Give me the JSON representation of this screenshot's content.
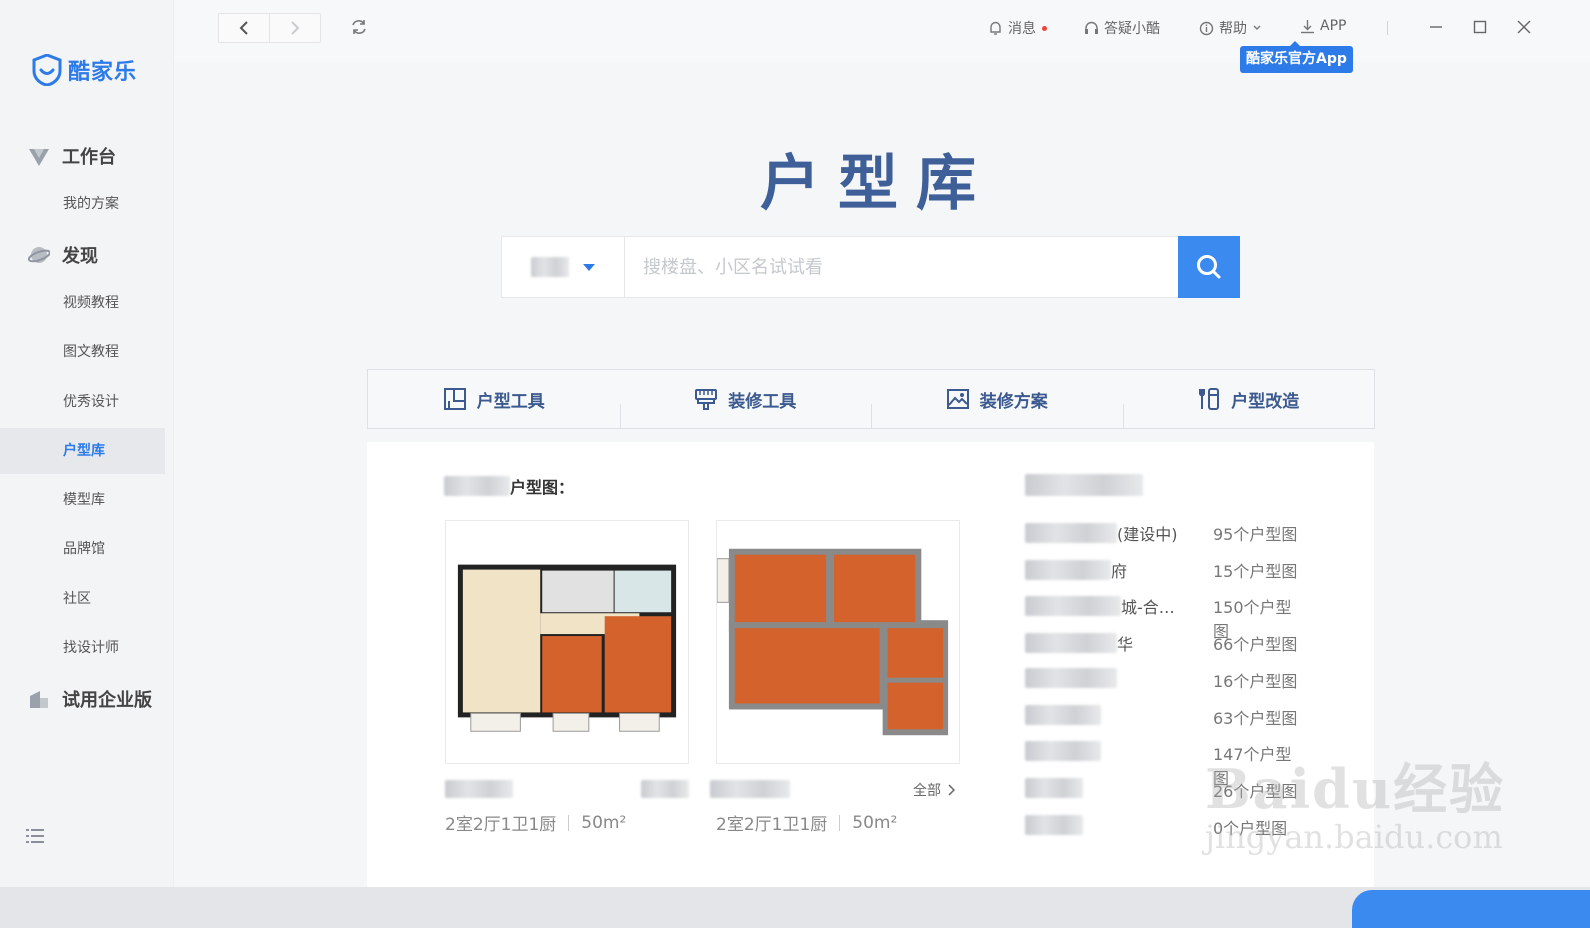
{
  "app": {
    "logo_text": "酷家乐",
    "brand_color": "#2d7be8"
  },
  "sidebar": {
    "groups": [
      {
        "label": "工作台",
        "icon": "workbench-icon"
      },
      {
        "label": "发现",
        "icon": "planet-icon"
      },
      {
        "label": "试用企业版",
        "icon": "enterprise-icon"
      }
    ],
    "items": [
      {
        "label": "我的方案"
      },
      {
        "label": "视频教程"
      },
      {
        "label": "图文教程"
      },
      {
        "label": "优秀设计"
      },
      {
        "label": "户型库",
        "active": true
      },
      {
        "label": "模型库"
      },
      {
        "label": "品牌馆"
      },
      {
        "label": "社区"
      },
      {
        "label": "找设计师"
      }
    ]
  },
  "topbar": {
    "messages": "消息",
    "qa": "答疑小酷",
    "help": "帮助",
    "app": "APP",
    "tooltip": "酷家乐官方App"
  },
  "main": {
    "title": "户型库",
    "search_placeholder": "搜楼盘、小区名试试看"
  },
  "tabs": [
    {
      "label": "户型工具",
      "icon": "floorplan-tool-icon"
    },
    {
      "label": "装修工具",
      "icon": "brush-icon"
    },
    {
      "label": "装修方案",
      "icon": "image-icon"
    },
    {
      "label": "户型改造",
      "icon": "tools-icon"
    }
  ],
  "panel": {
    "heading_suffix": "户型图：",
    "all_link": "全部",
    "cards": [
      {
        "info_rooms": "2室2厅1卫1厨",
        "info_area": "50m²"
      },
      {
        "info_rooms": "2室2厅1卫1厨",
        "info_area": "50m²"
      }
    ],
    "list": [
      {
        "name_visible": "(建设中)",
        "count": "95个户型图"
      },
      {
        "name_visible": "府",
        "count": "15个户型图"
      },
      {
        "name_visible": "城-合…",
        "count": "150个户型图"
      },
      {
        "name_visible": "华",
        "count": "66个户型图"
      },
      {
        "name_visible": "",
        "count": "16个户型图"
      },
      {
        "name_visible": "",
        "count": "63个户型图"
      },
      {
        "name_visible": "",
        "count": "147个户型图"
      },
      {
        "name_visible": "",
        "count": "26个户型图"
      },
      {
        "name_visible": "",
        "count": "0个户型图"
      }
    ]
  },
  "watermark": {
    "line1": "Baidu经验",
    "line2": "jingyan.baidu.com"
  }
}
